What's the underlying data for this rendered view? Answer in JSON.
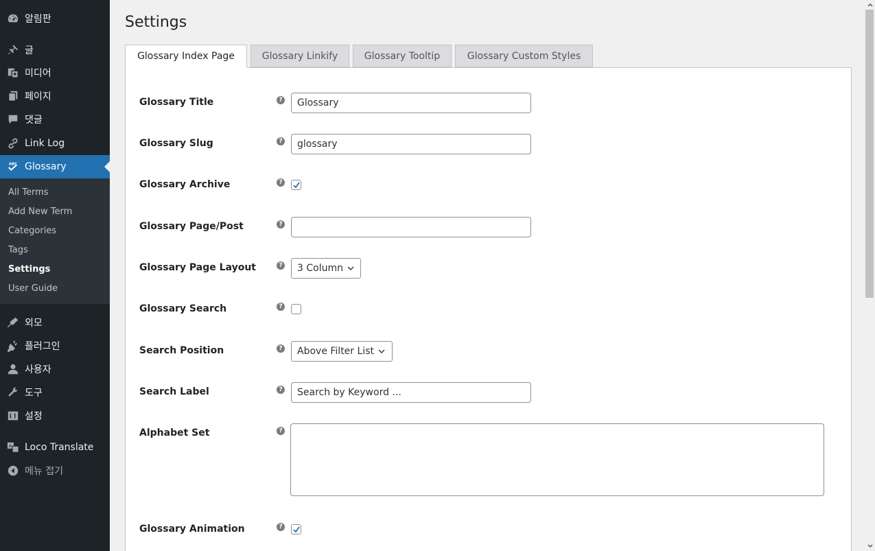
{
  "sidebar": {
    "items": [
      {
        "label": "알림판",
        "icon": "dashboard-icon"
      },
      {
        "label": "글",
        "icon": "pin-icon"
      },
      {
        "label": "미디어",
        "icon": "media-icon"
      },
      {
        "label": "페이지",
        "icon": "pages-icon"
      },
      {
        "label": "댓글",
        "icon": "comments-icon"
      },
      {
        "label": "Link Log",
        "icon": "link-icon"
      },
      {
        "label": "Glossary",
        "icon": "abc-check-icon"
      },
      {
        "label": "외모",
        "icon": "appearance-icon"
      },
      {
        "label": "플러그인",
        "icon": "plugins-icon"
      },
      {
        "label": "사용자",
        "icon": "users-icon"
      },
      {
        "label": "도구",
        "icon": "tools-icon"
      },
      {
        "label": "설정",
        "icon": "settings-icon"
      },
      {
        "label": "Loco Translate",
        "icon": "translate-icon"
      },
      {
        "label": "메뉴 접기",
        "icon": "collapse-icon"
      }
    ],
    "submenu": [
      "All Terms",
      "Add New Term",
      "Categories",
      "Tags",
      "Settings",
      "User Guide"
    ],
    "active_item": "Glossary",
    "current_sub": "Settings"
  },
  "page": {
    "title": "Settings"
  },
  "tabs": [
    "Glossary Index Page",
    "Glossary Linkify",
    "Glossary Tooltip",
    "Glossary Custom Styles"
  ],
  "form": {
    "glossary_title": {
      "label": "Glossary Title",
      "value": "Glossary"
    },
    "glossary_slug": {
      "label": "Glossary Slug",
      "value": "glossary"
    },
    "glossary_archive": {
      "label": "Glossary Archive",
      "checked": true
    },
    "glossary_page_post": {
      "label": "Glossary Page/Post",
      "value": ""
    },
    "glossary_page_layout": {
      "label": "Glossary Page Layout",
      "value": "3 Column"
    },
    "glossary_search": {
      "label": "Glossary Search",
      "checked": false
    },
    "search_position": {
      "label": "Search Position",
      "value": "Above Filter List"
    },
    "search_label": {
      "label": "Search Label",
      "value": "Search by Keyword ..."
    },
    "alphabet_set": {
      "label": "Alphabet Set",
      "value": ""
    },
    "glossary_animation": {
      "label": "Glossary Animation",
      "checked": true
    }
  },
  "help_glyph": "?",
  "colors": {
    "sidebar_bg": "#1d2327",
    "submenu_bg": "#2c3338",
    "accent": "#2271b1",
    "page_bg": "#f0f0f1"
  }
}
